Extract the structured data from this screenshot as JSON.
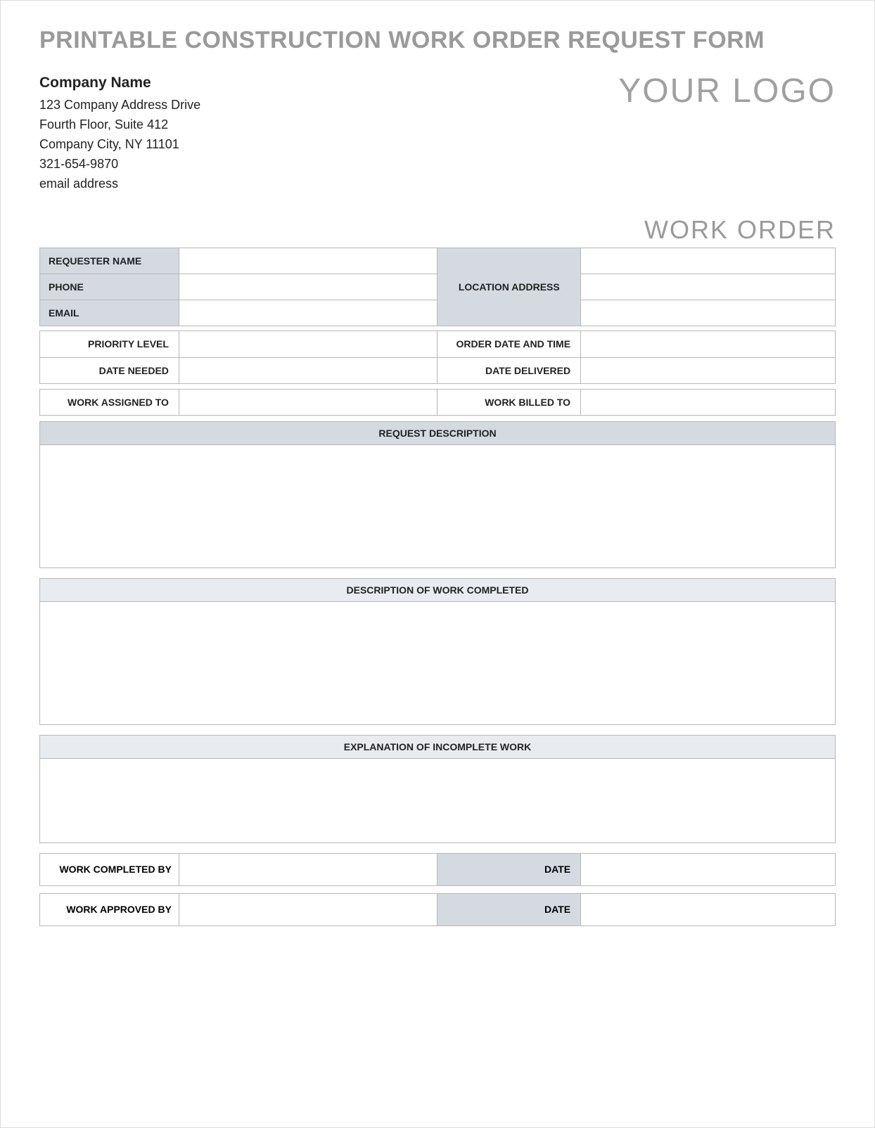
{
  "title": "PRINTABLE CONSTRUCTION WORK ORDER REQUEST FORM",
  "company": {
    "name": "Company Name",
    "address1": "123 Company Address Drive",
    "address2": "Fourth Floor, Suite 412",
    "city_line": "Company City, NY  11101",
    "phone": "321-654-9870",
    "email": "email address"
  },
  "logo_text": "YOUR LOGO",
  "work_order_label": "WORK ORDER",
  "fields": {
    "requester_name": "REQUESTER NAME",
    "phone": "PHONE",
    "email": "EMAIL",
    "location_address": "LOCATION ADDRESS",
    "priority_level": "PRIORITY LEVEL",
    "order_date_time": "ORDER DATE AND TIME",
    "date_needed": "DATE NEEDED",
    "date_delivered": "DATE DELIVERED",
    "work_assigned_to": "WORK ASSIGNED TO",
    "work_billed_to": "WORK BILLED TO"
  },
  "sections": {
    "request_description": "REQUEST DESCRIPTION",
    "work_completed_desc": "DESCRIPTION OF WORK COMPLETED",
    "incomplete_explanation": "EXPLANATION OF INCOMPLETE WORK"
  },
  "signoff": {
    "work_completed_by": "WORK COMPLETED BY",
    "work_approved_by": "WORK APPROVED BY",
    "date": "DATE"
  },
  "values": {
    "requester_name": "",
    "phone": "",
    "email": "",
    "location_addr_1": "",
    "location_addr_2": "",
    "location_addr_3": "",
    "priority_level": "",
    "order_date_time": "",
    "date_needed": "",
    "date_delivered": "",
    "work_assigned_to": "",
    "work_billed_to": "",
    "request_description": "",
    "work_completed_desc": "",
    "incomplete_explanation": "",
    "work_completed_by": "",
    "work_completed_date": "",
    "work_approved_by": "",
    "work_approved_date": ""
  }
}
